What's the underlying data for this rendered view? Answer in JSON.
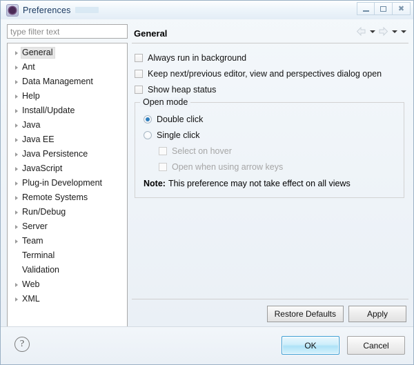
{
  "window": {
    "title": "Preferences",
    "icon": "preferences-gear-icon",
    "controls": {
      "minimize": "Minimize",
      "maximize": "Maximize",
      "close": "Close"
    }
  },
  "sidebar": {
    "filter": {
      "placeholder": "type filter text",
      "value": ""
    },
    "items": [
      {
        "label": "General",
        "expandable": true,
        "selected": true
      },
      {
        "label": "Ant",
        "expandable": true,
        "selected": false
      },
      {
        "label": "Data Management",
        "expandable": true,
        "selected": false
      },
      {
        "label": "Help",
        "expandable": true,
        "selected": false
      },
      {
        "label": "Install/Update",
        "expandable": true,
        "selected": false
      },
      {
        "label": "Java",
        "expandable": true,
        "selected": false
      },
      {
        "label": "Java EE",
        "expandable": true,
        "selected": false
      },
      {
        "label": "Java Persistence",
        "expandable": true,
        "selected": false
      },
      {
        "label": "JavaScript",
        "expandable": true,
        "selected": false
      },
      {
        "label": "Plug-in Development",
        "expandable": true,
        "selected": false
      },
      {
        "label": "Remote Systems",
        "expandable": true,
        "selected": false
      },
      {
        "label": "Run/Debug",
        "expandable": true,
        "selected": false
      },
      {
        "label": "Server",
        "expandable": true,
        "selected": false
      },
      {
        "label": "Team",
        "expandable": true,
        "selected": false
      },
      {
        "label": "Terminal",
        "expandable": false,
        "selected": false
      },
      {
        "label": "Validation",
        "expandable": false,
        "selected": false
      },
      {
        "label": "Web",
        "expandable": true,
        "selected": false
      },
      {
        "label": "XML",
        "expandable": true,
        "selected": false
      }
    ]
  },
  "page": {
    "title": "General",
    "nav": {
      "back": "back-arrow-icon",
      "back_menu": "back-history-dropdown",
      "forward": "forward-arrow-icon",
      "forward_menu": "forward-history-dropdown",
      "view_menu": "view-menu-dropdown"
    },
    "checkboxes": [
      {
        "label": "Always run in background",
        "checked": false,
        "disabled": false
      },
      {
        "label": "Keep next/previous editor, view and perspectives dialog open",
        "checked": false,
        "disabled": false
      },
      {
        "label": "Show heap status",
        "checked": false,
        "disabled": false
      }
    ],
    "open_mode": {
      "title": "Open mode",
      "radios": [
        {
          "label": "Double click",
          "selected": true
        },
        {
          "label": "Single click",
          "selected": false
        }
      ],
      "sub_checkboxes": [
        {
          "label": "Select on hover",
          "checked": false,
          "disabled": true
        },
        {
          "label": "Open when using arrow keys",
          "checked": false,
          "disabled": true
        }
      ],
      "note_bold": "Note:",
      "note_text": "This preference may not take effect on all views"
    },
    "buttons": {
      "restore_defaults": "Restore Defaults",
      "apply": "Apply"
    }
  },
  "footer": {
    "help": "?",
    "ok": "OK",
    "cancel": "Cancel"
  },
  "colors": {
    "accent": "#2e7ebd",
    "default_button_border": "#3c9ed4",
    "dialog_bg": "#eef3f8",
    "tree_bg": "#ffffff"
  }
}
